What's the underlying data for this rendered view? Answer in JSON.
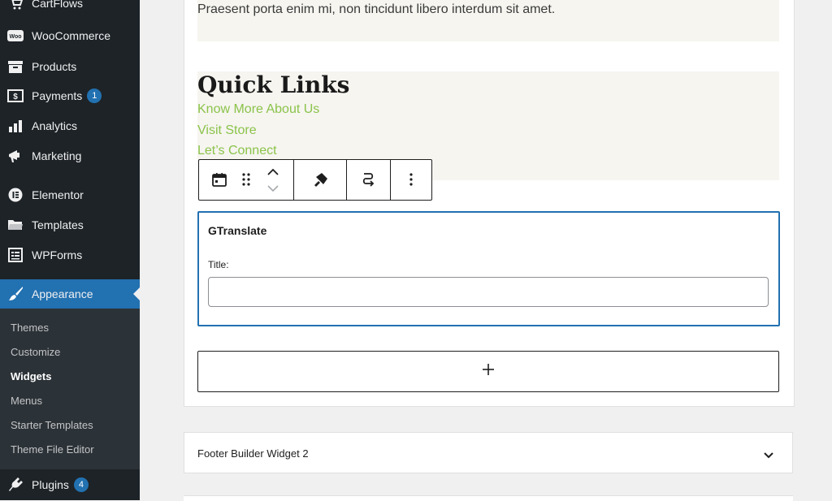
{
  "sidebar": {
    "top_partial": "CartFlows",
    "items": [
      {
        "label": "WooCommerce",
        "icon": "woo-icon"
      },
      {
        "label": "Products",
        "icon": "archive-icon"
      },
      {
        "label": "Payments",
        "icon": "payments-icon",
        "badge": "1"
      },
      {
        "label": "Analytics",
        "icon": "bar-chart-icon"
      },
      {
        "label": "Marketing",
        "icon": "megaphone-icon"
      },
      {
        "label": "Elementor",
        "icon": "elementor-icon"
      },
      {
        "label": "Templates",
        "icon": "folder-icon"
      },
      {
        "label": "WPForms",
        "icon": "form-icon"
      },
      {
        "label": "Appearance",
        "icon": "paintbrush-icon"
      },
      {
        "label": "Plugins",
        "icon": "plugin-icon",
        "badge": "4"
      }
    ],
    "submenu": [
      "Themes",
      "Customize",
      "Widgets",
      "Menus",
      "Starter Templates",
      "Theme File Editor"
    ],
    "current_submenu": "Widgets"
  },
  "content": {
    "paragraph": "Praesent porta enim mi, non tincidunt libero interdum sit amet.",
    "quick_links_title": "Quick Links",
    "links": [
      "Know More About Us",
      "Visit Store",
      "Let’s Connect"
    ]
  },
  "toolbar": {
    "icons": [
      "calendar-icon",
      "drag-handle-icon",
      "move-up-icon",
      "move-down-icon",
      "paintbrush-icon",
      "transform-icon",
      "more-options-icon"
    ]
  },
  "gtranslate": {
    "title": "GTranslate",
    "field_label": "Title:",
    "field_value": ""
  },
  "add_block": {
    "label": "+"
  },
  "footer_widget": {
    "title": "Footer Builder Widget 2"
  },
  "colors": {
    "sidebar_bg": "#1d2327",
    "accent": "#2271b1",
    "link_green": "#8bc34a",
    "block_bg": "#f6f5f0"
  }
}
